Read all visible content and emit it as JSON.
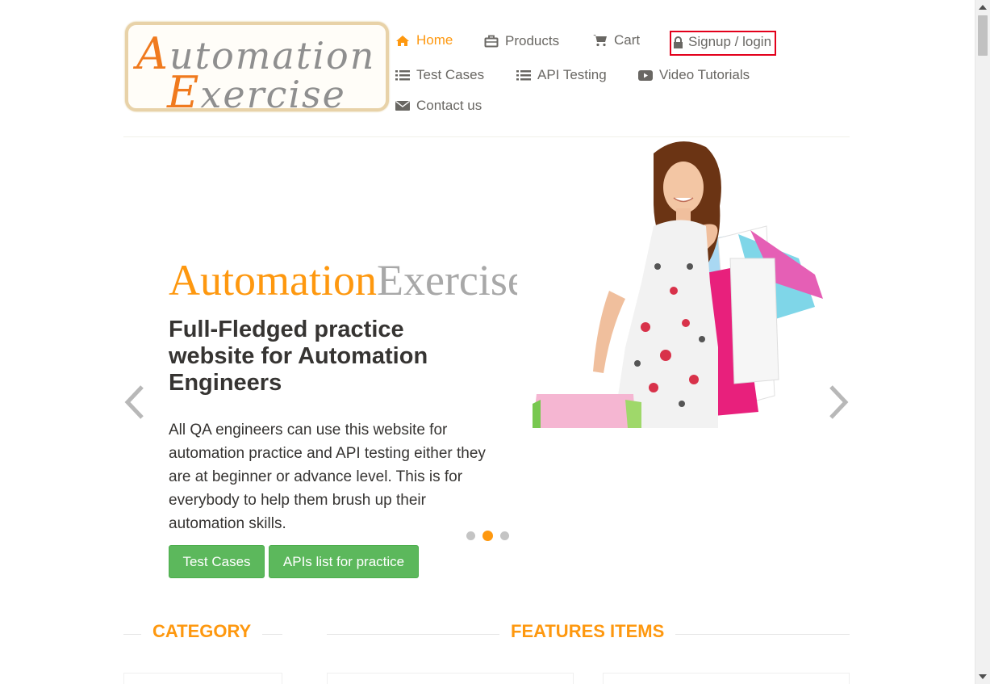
{
  "logo": {
    "line1_cap": "A",
    "line1_rest": "utomation",
    "line2_cap": "E",
    "line2_rest": "xercise"
  },
  "nav": {
    "items": [
      {
        "label": "Home",
        "icon": "home-icon"
      },
      {
        "label": "Products",
        "icon": "briefcase-icon"
      },
      {
        "label": "Cart",
        "icon": "cart-icon"
      },
      {
        "label": "Signup / login",
        "icon": "lock-icon"
      },
      {
        "label": "Test Cases",
        "icon": "list-icon"
      },
      {
        "label": "API Testing",
        "icon": "list-icon"
      },
      {
        "label": "Video Tutorials",
        "icon": "youtube-play-icon"
      },
      {
        "label": "Contact us",
        "icon": "envelope-icon"
      }
    ]
  },
  "slider": {
    "brand_orange": "Automation",
    "brand_grey": "Exercise",
    "heading": "Full-Fledged practice website for Automation Engineers",
    "text": "All QA engineers can use this website for automation practice and API testing either they are at beginner or advance level. This is for everybody to help them brush up their automation skills.",
    "btn_test_cases": "Test Cases",
    "btn_apis": "APIs list for practice",
    "active_slide": 2,
    "slide_count": 3
  },
  "sections": {
    "category": "CATEGORY",
    "features": "FEATURES ITEMS"
  },
  "colors": {
    "accent": "#fe980f",
    "button_green": "#5cb85c",
    "highlight_red": "#e3001b"
  }
}
